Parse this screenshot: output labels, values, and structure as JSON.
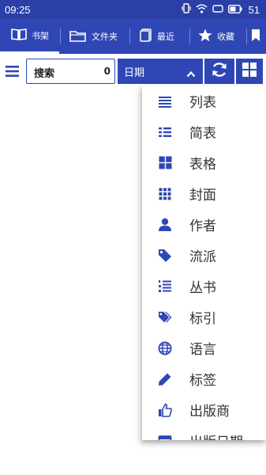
{
  "status_bar": {
    "time": "09:25",
    "battery": "51"
  },
  "tabs": [
    {
      "label": "书架",
      "icon": "book-open-icon",
      "active": true
    },
    {
      "label": "文件夹",
      "icon": "folder-icon",
      "active": false
    },
    {
      "label": "最近",
      "icon": "recent-icon",
      "active": false
    },
    {
      "label": "收藏",
      "icon": "star-icon",
      "active": false
    }
  ],
  "toolbar": {
    "search_label": "搜索",
    "search_count": "0",
    "sort_value": "日期"
  },
  "dropdown": {
    "items": [
      {
        "label": "列表",
        "icon": "list-icon"
      },
      {
        "label": "简表",
        "icon": "compact-list-icon"
      },
      {
        "label": "表格",
        "icon": "grid-large-icon"
      },
      {
        "label": "封面",
        "icon": "grid-small-icon"
      },
      {
        "label": "作者",
        "icon": "person-icon"
      },
      {
        "label": "流派",
        "icon": "tag-icon"
      },
      {
        "label": "丛书",
        "icon": "numbered-list-icon"
      },
      {
        "label": "标引",
        "icon": "tags-icon"
      },
      {
        "label": "语言",
        "icon": "globe-icon"
      },
      {
        "label": "标签",
        "icon": "pencil-icon"
      },
      {
        "label": "出版商",
        "icon": "thumbs-up-icon"
      },
      {
        "label": "出版日期",
        "icon": "calendar-icon"
      }
    ]
  },
  "colors": {
    "primary": "#2f46b5",
    "status_bar": "#2b3fa6",
    "icon": "#2f46b5",
    "text": "#333333"
  }
}
